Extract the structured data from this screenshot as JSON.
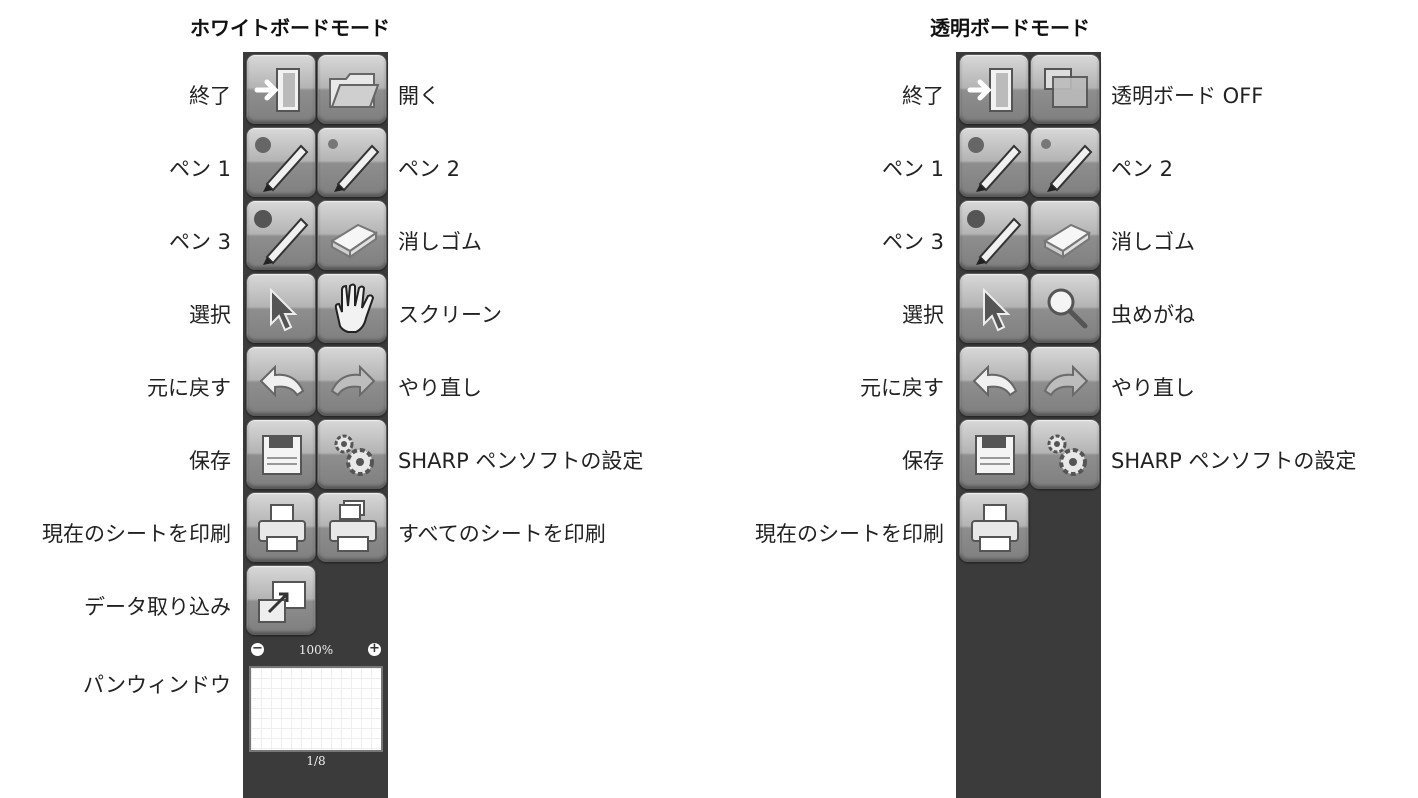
{
  "whiteboard": {
    "title": "ホワイトボードモード",
    "left_labels": [
      "終了",
      "ペン 1",
      "ペン 3",
      "選択",
      "元に戻す",
      "保存",
      "現在のシートを印刷",
      "データ取り込み",
      "パンウィンドウ"
    ],
    "right_labels": [
      "開く",
      "ペン 2",
      "消しゴム",
      "スクリーン",
      "やり直し",
      "SHARP ペンソフトの設定",
      "すべてのシートを印刷"
    ],
    "pan_window": {
      "zoom": "100%",
      "minus": "−",
      "plus": "+",
      "page": "1/8"
    }
  },
  "transparent": {
    "title": "透明ボードモード",
    "left_labels": [
      "終了",
      "ペン 1",
      "ペン 3",
      "選択",
      "元に戻す",
      "保存",
      "現在のシートを印刷"
    ],
    "right_labels": [
      "透明ボード OFF",
      "ペン 2",
      "消しゴム",
      "虫めがね",
      "やり直し",
      "SHARP ペンソフトの設定"
    ]
  },
  "colors": {
    "panel": "#3b3b3b",
    "button_light": "#d8d8d8",
    "button_dark": "#7f7f7f"
  }
}
